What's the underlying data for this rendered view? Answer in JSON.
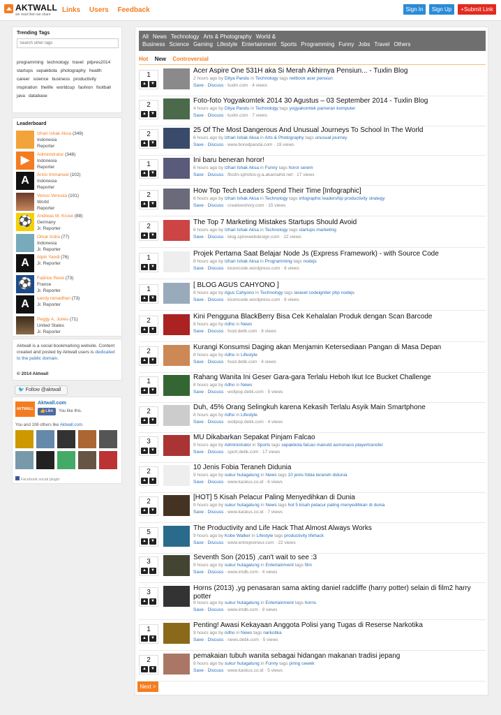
{
  "brand": {
    "name": "AKTWALL",
    "tagline": "we read then we share"
  },
  "topnav": [
    "Links",
    "Users",
    "Feedback"
  ],
  "auth": {
    "signin": "Sign In",
    "signup": "Sign Up",
    "submit": "+Submit Link"
  },
  "trending": {
    "title": "Trending Tags",
    "search_placeholder": "Search other tags",
    "tags": [
      "programming",
      "technology",
      "travel",
      "pilpres2014",
      "startups",
      "sepakbola",
      "photography",
      "health",
      "career",
      "science",
      "business",
      "productivity",
      "inspiration",
      "thelife",
      "worldcup",
      "fashion",
      "football",
      "java",
      "database"
    ]
  },
  "leaderboard": {
    "title": "Leaderboard",
    "users": [
      {
        "name": "Izhari Ishak Aksa",
        "count": "(349)",
        "country": "Indonesia",
        "rank": "Reporter"
      },
      {
        "name": "Administrator",
        "count": "(348)",
        "country": "Indonesia",
        "rank": "Reporter"
      },
      {
        "name": "Arion Immanuel",
        "count": "(102)",
        "country": "Indonesia",
        "rank": "Reporter"
      },
      {
        "name": "Venus Venusia",
        "count": "(101)",
        "country": "World",
        "rank": "Reporter"
      },
      {
        "name": "Andreas M. Kruse",
        "count": "(88)",
        "country": "Germany",
        "rank": "Jr. Reporter"
      },
      {
        "name": "Omar Indra",
        "count": "(77)",
        "country": "Indonesia",
        "rank": "Jr. Reporter"
      },
      {
        "name": "Alpiri Yandi",
        "count": "(76)",
        "country": "",
        "rank": "Jr. Reporter"
      },
      {
        "name": "Fabrice René",
        "count": "(73)",
        "country": "France",
        "rank": "Jr. Reporter"
      },
      {
        "name": "sandy.ramadhan",
        "count": "(73)",
        "country": "",
        "rank": "Jr. Reporter"
      },
      {
        "name": "Peggy A. Jones",
        "count": "(71)",
        "country": "United States",
        "rank": "Jr. Reporter"
      }
    ]
  },
  "about": {
    "text": "Aktwall is a social bookmarking website. Content created and posted by Aktwall users is",
    "link": "dedicated to the public domain.",
    "copyright": "© 2014 Aktwall"
  },
  "social": {
    "follow": "Follow @aktwall",
    "fb_name": "Aktwall.com",
    "like": "Like",
    "you_like": "You like this.",
    "others": "You and 108 others like",
    "others_link": "Aktwall.com.",
    "plugin": "Facebook social plugin"
  },
  "categories": [
    "All",
    "News",
    "Technology",
    "Arts & Photography",
    "World & Business",
    "Science",
    "Gaming",
    "Lifestyle",
    "Entertainment",
    "Sports",
    "Programming",
    "Funny",
    "Jobs",
    "Travel",
    "Others"
  ],
  "sorts": [
    "Hot",
    "New",
    "Controversial"
  ],
  "labels": {
    "save": "Save",
    "discuss": "Discuss",
    "next": "Next >",
    "in": "in",
    "tags": "tags",
    "by": "ago by"
  },
  "posts": [
    {
      "votes": "1",
      "title": "Acer Aspire One 531H aka Si Merah Akhirnya Pensiun... - Tuxlin Blog",
      "time": "2 hours",
      "author": "Dityа Pandu",
      "cat": "Technology",
      "tags": "netbook acer pensiun",
      "domain": "tuxlin.com",
      "views": "4 views"
    },
    {
      "votes": "2",
      "title": "Foto-foto Yogyakomtek 2014 30 Agustus – 03 September 2014 - Tuxlin Blog",
      "time": "4 hours",
      "author": "Dityа Pandu",
      "cat": "Technology",
      "tags": "yogyakomtek pameran komputer",
      "domain": "tuxlin.com",
      "views": "7 views"
    },
    {
      "votes": "2",
      "title": "25 Of The Most Dangerous And Unusual Journeys To School In The World",
      "time": "6 hours",
      "author": "Izhari Ishak Aksa",
      "cat": "Arts & Photography",
      "tags": "unusual journey",
      "domain": "www.boredpanda.com",
      "views": "19 views"
    },
    {
      "votes": "1",
      "title": "Ini baru beneran horor!",
      "time": "6 hours",
      "author": "Izhari Ishak Aksa",
      "cat": "Funny",
      "tags": "horor serem",
      "domain": "fbcdn-sphotos-g-a.akamaihd.net",
      "views": "17 views"
    },
    {
      "votes": "2",
      "title": "How Top Tech Leaders Spend Their Time [Infographic]",
      "time": "6 hours",
      "author": "Izhari Ishak Aksa",
      "cat": "Technology",
      "tags": "infographic leadership productivity strategy",
      "domain": "creativeshory.com",
      "views": "15 views"
    },
    {
      "votes": "2",
      "title": "The Top 7 Marketing Mistakes Startups Should Avoid",
      "time": "6 hours",
      "author": "Izhari Ishak Aksa",
      "cat": "Technology",
      "tags": "startups marketing",
      "domain": "blog.spinxwebdesign.com",
      "views": "22 views"
    },
    {
      "votes": "1",
      "title": "Projek Pertama Saat Belajar Node Js (Express Framework) - with Source Code",
      "time": "8 hours",
      "author": "Izhari Ishak Aksa",
      "cat": "Programming",
      "tags": "nodejs",
      "domain": "kicencode.wordpress.com",
      "views": "6 views"
    },
    {
      "votes": "1",
      "title": "[ BLOG AGUS CAHYONO ]",
      "time": "8 hours",
      "author": "Agus Cahyono",
      "cat": "Technology",
      "tags": "laravel codeigniter php nodejs",
      "domain": "kicencode.wordpress.com",
      "views": "6 views"
    },
    {
      "votes": "2",
      "title": "Kini Pengguna BlackBerry Bisa Cek Kehalalan Produk dengan Scan Barcode",
      "time": "8 hours",
      "author": "ridho",
      "cat": "News",
      "tags": "",
      "domain": "food.detik.com",
      "views": "8 views"
    },
    {
      "votes": "2",
      "title": "Kurangi Konsumsi Daging akan Menjamin Ketersediaan Pangan di Masa Depan",
      "time": "8 hours",
      "author": "ridho",
      "cat": "Lifestyle",
      "tags": "",
      "domain": "food.detik.com",
      "views": "4 views"
    },
    {
      "votes": "1",
      "title": "Rahang Wanita Ini Geser Gara-gara Terlalu Heboh Ikut Ice Bucket Challenge",
      "time": "8 hours",
      "author": "ridho",
      "cat": "News",
      "tags": "",
      "domain": "wolipop.detik.com",
      "views": "5 views"
    },
    {
      "votes": "2",
      "title": "Duh, 45% Orang Selingkuh karena Kekasih Terlalu Asyik Main Smartphone",
      "time": "8 hours",
      "author": "ridho",
      "cat": "Lifestyle",
      "tags": "",
      "domain": "wolipop.detik.com",
      "views": "4 views"
    },
    {
      "votes": "3",
      "title": "MU Dikabarkan Sepakat Pinjam Falcao",
      "time": "9 hours",
      "author": "Administrator",
      "cat": "Sports",
      "tags": "sepakbola falcao manutd asmonaco playertransfer",
      "domain": "sport.detik.com",
      "views": "17 views"
    },
    {
      "votes": "2",
      "title": "10 Jenis Fobia Teraneh Didunia",
      "time": "9 hours",
      "author": "sukur hutagalung",
      "cat": "News",
      "tags": "10 jenis fobia teraneh didunia",
      "domain": "www.kaskus.co.id",
      "views": "6 views"
    },
    {
      "votes": "2",
      "title": "[HOT] 5 Kisah Pelacur Paling Menyedihkan di Dunia",
      "time": "9 hours",
      "author": "sukur hutagalung",
      "cat": "News",
      "tags": "hot 5 kisah pelacur paling menyedihkan di dunia",
      "domain": "www.kaskus.co.id",
      "views": "7 views"
    },
    {
      "votes": "5",
      "title": "The Productivity and Life Hack That Almost Always Works",
      "time": "9 hours",
      "author": "Kobe Walker",
      "cat": "Lifestyle",
      "tags": "productivity lifehack",
      "domain": "www.entrepreneur.com",
      "views": "22 views"
    },
    {
      "votes": "3",
      "title": "Seventh Son (2015) ,can't wait to see :3",
      "time": "9 hours",
      "author": "sukur hutagalung",
      "cat": "Entertainment",
      "tags": "film",
      "domain": "www.imdb.com",
      "views": "4 views"
    },
    {
      "votes": "3",
      "title": "Horns (2013) ,yg penasaran sama akting daniel radcliffe (harry potter) selain di film2 harry potter",
      "time": "9 hours",
      "author": "sukur hutagalung",
      "cat": "Entertainment",
      "tags": "horns",
      "domain": "www.imdb.com",
      "views": "9 views"
    },
    {
      "votes": "1",
      "title": "Penting! Awasi Kekayaan Anggota Polisi yang Tugas di Reserse Narkotika",
      "time": "9 hours",
      "author": "ridho",
      "cat": "News",
      "tags": "narkotika",
      "domain": "news.detik.com",
      "views": "5 views"
    },
    {
      "votes": "2",
      "title": "pemakaian tubuh wanita sebagai hidangan makanan tradisi jepang",
      "time": "9 hours",
      "author": "sukur hutagalung",
      "cat": "Funny",
      "tags": "piring cewek",
      "domain": "www.kaskus.co.id",
      "views": "5 views"
    }
  ],
  "colors": {
    "accent": "#f47c20",
    "link": "#2a6ebb",
    "signin": "#2a8bd8",
    "submit": "#e22a20",
    "category_bar": "#6f6f6f"
  }
}
